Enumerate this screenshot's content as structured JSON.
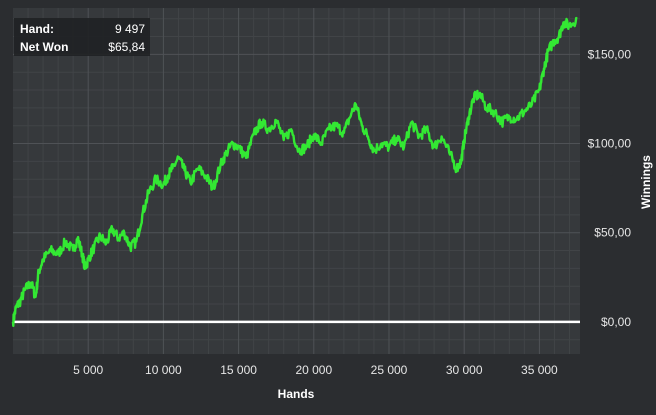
{
  "info_box": {
    "hand_label": "Hand:",
    "hand_value": "9 497",
    "net_won_label": "Net Won",
    "net_won_value": "$65,84"
  },
  "colors": {
    "background": "#2b2d30",
    "plot_area": "#36393c",
    "grid_major": "#4f5256",
    "grid_minor": "#414447",
    "series": "#33e833",
    "zero_line": "#ffffff",
    "info_box": "#1f2123"
  },
  "chart_data": {
    "type": "line",
    "xlabel": "Hands",
    "ylabel": "Winnings",
    "xlim": [
      0,
      37700
    ],
    "ylim": [
      -18,
      176
    ],
    "grid": true,
    "x_ticks": [
      5000,
      10000,
      15000,
      20000,
      25000,
      30000,
      35000
    ],
    "x_tick_labels": [
      "5 000",
      "10 000",
      "15 000",
      "20 000",
      "25 000",
      "30 000",
      "35 000"
    ],
    "y_ticks": [
      0,
      50,
      100,
      150
    ],
    "y_tick_labels": [
      "$0,00",
      "$50,00",
      "$100,00",
      "$150,00"
    ],
    "zero_line_value": 0,
    "series": [
      {
        "x": [
          0,
          200,
          500,
          800,
          1200,
          1500,
          1700,
          2000,
          2500,
          3000,
          3500,
          4000,
          4300,
          4600,
          4800,
          5000,
          5400,
          5800,
          6200,
          6600,
          7000,
          7400,
          7800,
          8200,
          8600,
          9000,
          9500,
          10000,
          10300,
          10600,
          11000,
          11400,
          11800,
          12300,
          12800,
          13300,
          13800,
          14200,
          14600,
          15000,
          15500,
          16000,
          16500,
          17000,
          17500,
          18000,
          18500,
          19000,
          19500,
          20000,
          20500,
          21000,
          21500,
          22000,
          22500,
          22800,
          23200,
          23600,
          24000,
          24500,
          25000,
          25500,
          26000,
          26500,
          27000,
          27500,
          28000,
          28500,
          29000,
          29500,
          29800,
          30000,
          30300,
          30600,
          31000,
          31500,
          32000,
          32500,
          33000,
          33500,
          34000,
          34500,
          35000,
          35300,
          35600,
          36000,
          36300,
          36600,
          37000,
          37500
        ],
        "y": [
          0,
          8,
          12,
          18,
          22,
          14,
          28,
          35,
          40,
          38,
          45,
          40,
          47,
          38,
          30,
          35,
          42,
          48,
          44,
          52,
          47,
          50,
          42,
          45,
          60,
          72,
          80,
          77,
          82,
          86,
          92,
          85,
          78,
          86,
          82,
          75,
          88,
          95,
          100,
          98,
          92,
          105,
          112,
          108,
          113,
          102,
          108,
          96,
          98,
          105,
          100,
          108,
          110,
          106,
          117,
          122,
          110,
          104,
          96,
          100,
          98,
          103,
          98,
          112,
          104,
          108,
          98,
          104,
          95,
          86,
          90,
          102,
          115,
          125,
          128,
          120,
          118,
          112,
          115,
          114,
          118,
          122,
          130,
          142,
          152,
          158,
          160,
          168,
          166,
          170
        ]
      }
    ]
  }
}
